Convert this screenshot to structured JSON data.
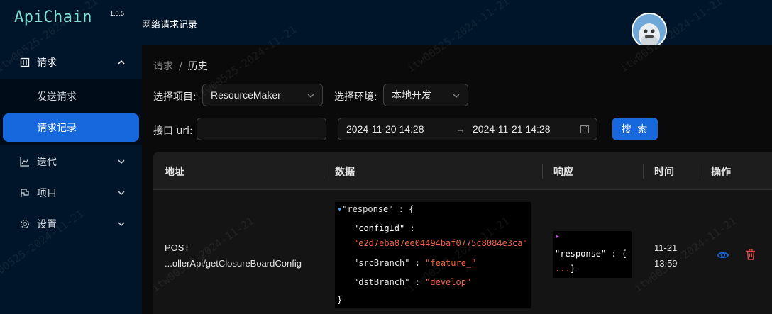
{
  "app": {
    "name": "ApiChain",
    "version": "1.0.5"
  },
  "header": {
    "title": "网络请求记录"
  },
  "sidebar": {
    "items": [
      {
        "label": "请求",
        "icon": "square-icon",
        "expanded": true
      },
      {
        "label": "迭代",
        "icon": "chart-line-icon",
        "expanded": false
      },
      {
        "label": "项目",
        "icon": "flag-icon",
        "expanded": false
      },
      {
        "label": "设置",
        "icon": "gear-icon",
        "expanded": false
      }
    ],
    "subitems": [
      {
        "label": "发送请求",
        "active": false
      },
      {
        "label": "请求记录",
        "active": true
      }
    ]
  },
  "breadcrumb": {
    "parent": "请求",
    "separator": "/",
    "current": "历史"
  },
  "filters": {
    "project_label": "选择项目:",
    "project_value": "ResourceMaker",
    "env_label": "选择环境:",
    "env_value": "本地开发",
    "uri_label": "接口 uri:",
    "uri_value": "",
    "date_start": "2024-11-20 14:28",
    "date_arrow": "→",
    "date_end": "2024-11-21 14:28",
    "search_label": "搜 索"
  },
  "table": {
    "columns": [
      "地址",
      "数据",
      "响应",
      "时间",
      "操作"
    ],
    "rows": [
      {
        "method": "POST",
        "uri": "...ollerApi/getClosureBoardConfig",
        "data_json": {
          "root_key": "\"response\" : {",
          "configId_key": "\"configId\" :",
          "configId_val": "\"e2d7eba87ee04494baf0775c8084e3ca\"",
          "srcBranch_key": "\"srcBranch\" :",
          "srcBranch_val": "\"feature_\"",
          "dstBranch_key": "\"dstBranch\" :",
          "dstBranch_val": "\"develop\"",
          "close": "}"
        },
        "response_json": {
          "root_key": "\"response\" : {",
          "ellipsis": "...",
          "close": "}"
        },
        "date": "11-21",
        "time": "13:59"
      }
    ]
  },
  "watermark": "itw00525-2024-11-21",
  "colors": {
    "accent": "#1668dc",
    "sidebar": "#001529",
    "json_string": "#f06548",
    "delete": "#e84749"
  }
}
